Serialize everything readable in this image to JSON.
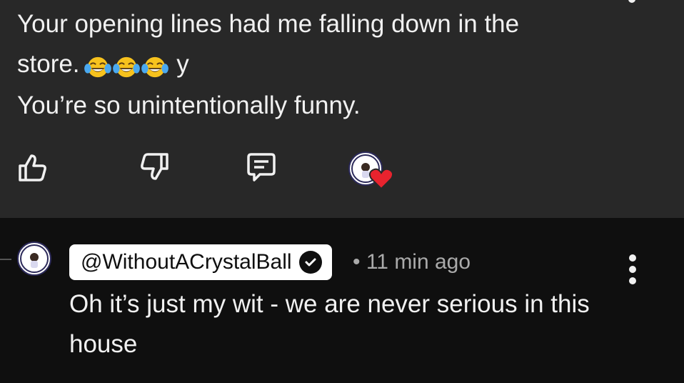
{
  "comment": {
    "line1": "Your opening lines had me falling down in the",
    "line2_prefix": "store.",
    "emoji": [
      "face-with-tears-of-joy",
      "face-with-tears-of-joy",
      "face-with-tears-of-joy"
    ],
    "line2_suffix": " y",
    "line3": "You’re so unintentionally funny."
  },
  "actions": {
    "like_icon": "thumbs-up-icon",
    "dislike_icon": "thumbs-down-icon",
    "reply_icon": "reply-comment-icon",
    "creator_heart_icon": "creator-heart-icon"
  },
  "reply": {
    "handle": "@WithoutACrystalBall",
    "meta": "• 11 min ago",
    "text": "Oh it’s just my wit - we are never serious in this house"
  },
  "colors": {
    "top_bg": "#282828",
    "bottom_bg": "#0f0f0f",
    "heart": "#e8232e",
    "secondary_text": "#aaaaaa"
  }
}
